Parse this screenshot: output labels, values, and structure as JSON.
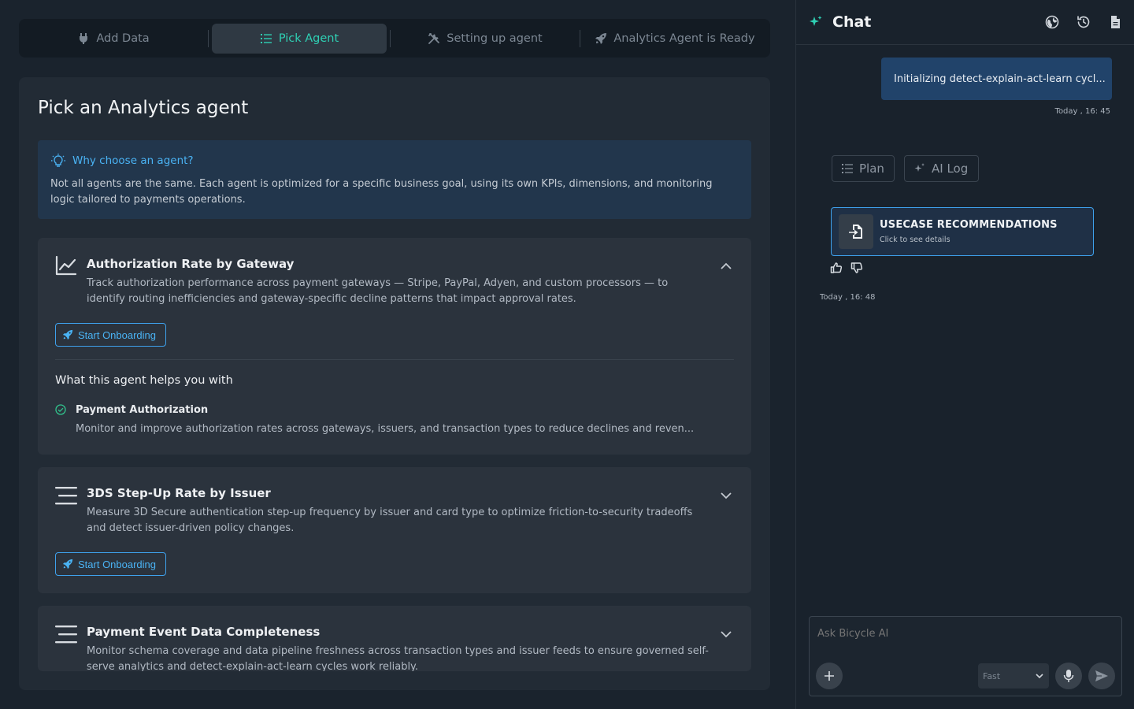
{
  "stepper": {
    "steps": [
      {
        "label": "Add Data",
        "icon": "plug-icon"
      },
      {
        "label": "Pick Agent",
        "icon": "list-icon"
      },
      {
        "label": "Setting up agent",
        "icon": "tools-icon"
      },
      {
        "label": "Analytics Agent is Ready",
        "icon": "rocket-icon"
      }
    ],
    "active_index": 1
  },
  "panel": {
    "title": "Pick an Analytics agent",
    "info": {
      "heading": "Why choose an agent?",
      "text": "Not all agents are the same. Each agent is optimized for a specific business goal, using its own KPIs, dimensions, and monitoring logic tailored to payments operations."
    },
    "agents": [
      {
        "title": "Authorization Rate by Gateway",
        "description": "Track authorization performance across payment gateways — Stripe, PayPal, Adyen, and custom processors — to identify routing inefficiencies and gateway-specific decline patterns that impact approval rates.",
        "button": "Start Onboarding",
        "expanded": true,
        "helps_title": "What this agent helps you with",
        "features": [
          {
            "name": "Payment Authorization",
            "description": "Monitor and improve authorization rates across gateways, issuers, and transaction types to reduce declines and reven..."
          }
        ]
      },
      {
        "title": "3DS Step-Up Rate by Issuer",
        "description": "Measure 3D Secure authentication step-up frequency by issuer and card type to optimize friction-to-security tradeoffs and detect issuer-driven policy changes.",
        "button": "Start Onboarding",
        "expanded": false
      },
      {
        "title": "Payment Event Data Completeness",
        "description": "Monitor schema coverage and data pipeline freshness across transaction types and issuer feeds to ensure governed self-serve analytics and detect-explain-act-learn cycles work reliably.",
        "expanded": false
      }
    ]
  },
  "chat": {
    "title": "Chat",
    "user_message": "Initializing detect-explain-act-learn cycl...",
    "user_timestamp": "Today , 16: 45",
    "chips": [
      "Plan",
      "AI Log"
    ],
    "recommendation": {
      "title": "USECASE RECOMMENDATIONS",
      "subtitle": "Click to see details"
    },
    "bot_timestamp": "Today , 16: 48",
    "composer": {
      "placeholder": "Ask Bicycle AI",
      "model": "Fast"
    }
  },
  "colors": {
    "accent_teal": "#2fd0b4",
    "accent_blue": "#4ab3f4",
    "user_bubble": "#21436a"
  }
}
